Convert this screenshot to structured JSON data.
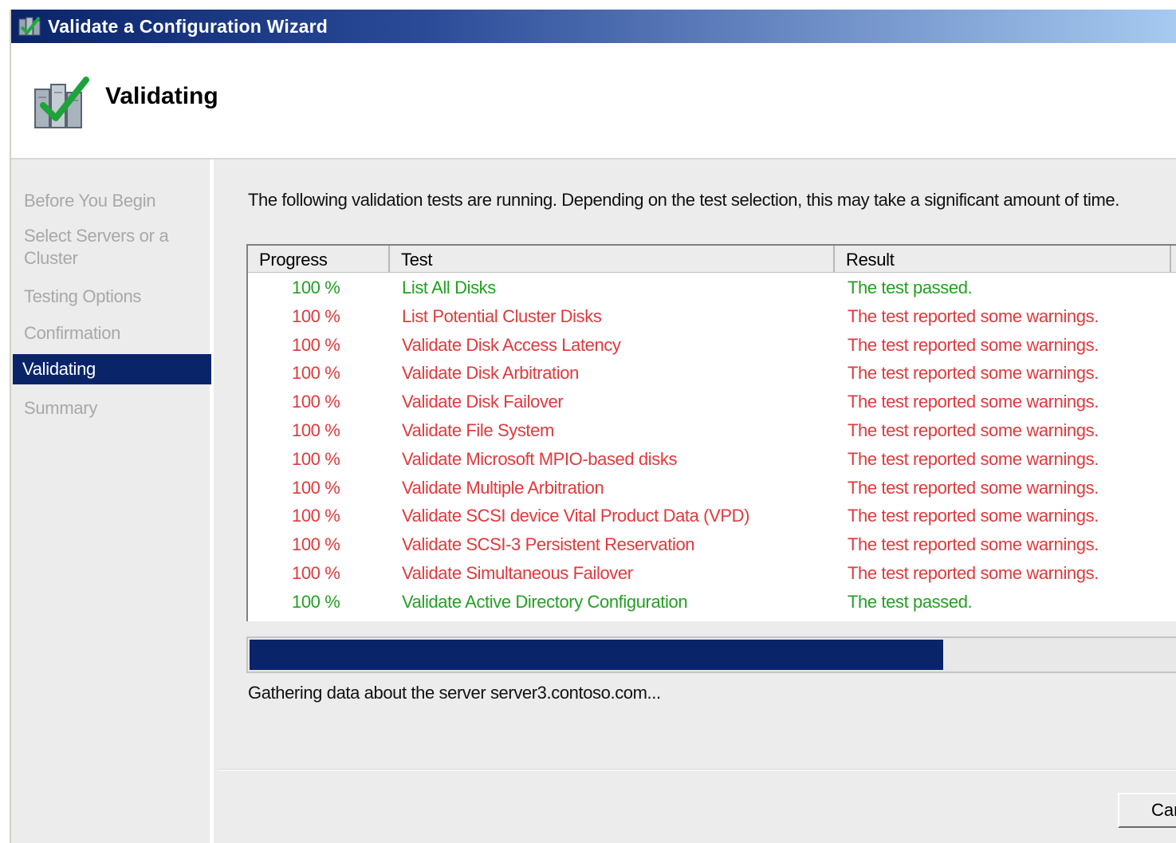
{
  "window": {
    "title": "Validate a Configuration Wizard"
  },
  "header": {
    "title": "Validating"
  },
  "sidebar": {
    "items": [
      {
        "label": "Before You Begin"
      },
      {
        "label": "Select Servers or a Cluster"
      },
      {
        "label": "Testing Options"
      },
      {
        "label": "Confirmation"
      },
      {
        "label": "Validating",
        "active": true
      },
      {
        "label": "Summary"
      }
    ]
  },
  "main": {
    "intro": "The following validation tests are running. Depending on the test selection, this may take a significant amount of time.",
    "table": {
      "columns": [
        "Progress",
        "Test",
        "Result"
      ],
      "rows": [
        {
          "progress": "100 %",
          "test": "List All Disks",
          "result": "The test passed.",
          "status": "passed"
        },
        {
          "progress": "100 %",
          "test": "List Potential Cluster Disks",
          "result": "The test reported some warnings.",
          "status": "warning"
        },
        {
          "progress": "100 %",
          "test": "Validate Disk Access Latency",
          "result": "The test reported some warnings.",
          "status": "warning"
        },
        {
          "progress": "100 %",
          "test": "Validate Disk Arbitration",
          "result": "The test reported some warnings.",
          "status": "warning"
        },
        {
          "progress": "100 %",
          "test": "Validate Disk Failover",
          "result": "The test reported some warnings.",
          "status": "warning"
        },
        {
          "progress": "100 %",
          "test": "Validate File System",
          "result": "The test reported some warnings.",
          "status": "warning"
        },
        {
          "progress": "100 %",
          "test": "Validate Microsoft MPIO-based disks",
          "result": "The test reported some warnings.",
          "status": "warning"
        },
        {
          "progress": "100 %",
          "test": "Validate Multiple Arbitration",
          "result": "The test reported some warnings.",
          "status": "warning"
        },
        {
          "progress": "100 %",
          "test": "Validate SCSI device Vital Product Data (VPD)",
          "result": "The test reported some warnings.",
          "status": "warning"
        },
        {
          "progress": "100 %",
          "test": "Validate SCSI-3 Persistent Reservation",
          "result": "The test reported some warnings.",
          "status": "warning"
        },
        {
          "progress": "100 %",
          "test": "Validate Simultaneous Failover",
          "result": "The test reported some warnings.",
          "status": "warning"
        },
        {
          "progress": "100 %",
          "test": "Validate Active Directory Configuration",
          "result": "The test passed.",
          "status": "passed"
        }
      ]
    },
    "progress_fraction": 0.75,
    "status": "Gathering data about the server server3.contoso.com..."
  },
  "footer": {
    "cancel_label": "Cancel"
  },
  "colors": {
    "title_gradient_start": "#0a246a",
    "selection": "#0a246a",
    "passed": "#22a022",
    "warning": "#e0393c"
  },
  "icons": {
    "title": "cluster-validate-icon",
    "header": "cluster-checkmark-icon"
  }
}
